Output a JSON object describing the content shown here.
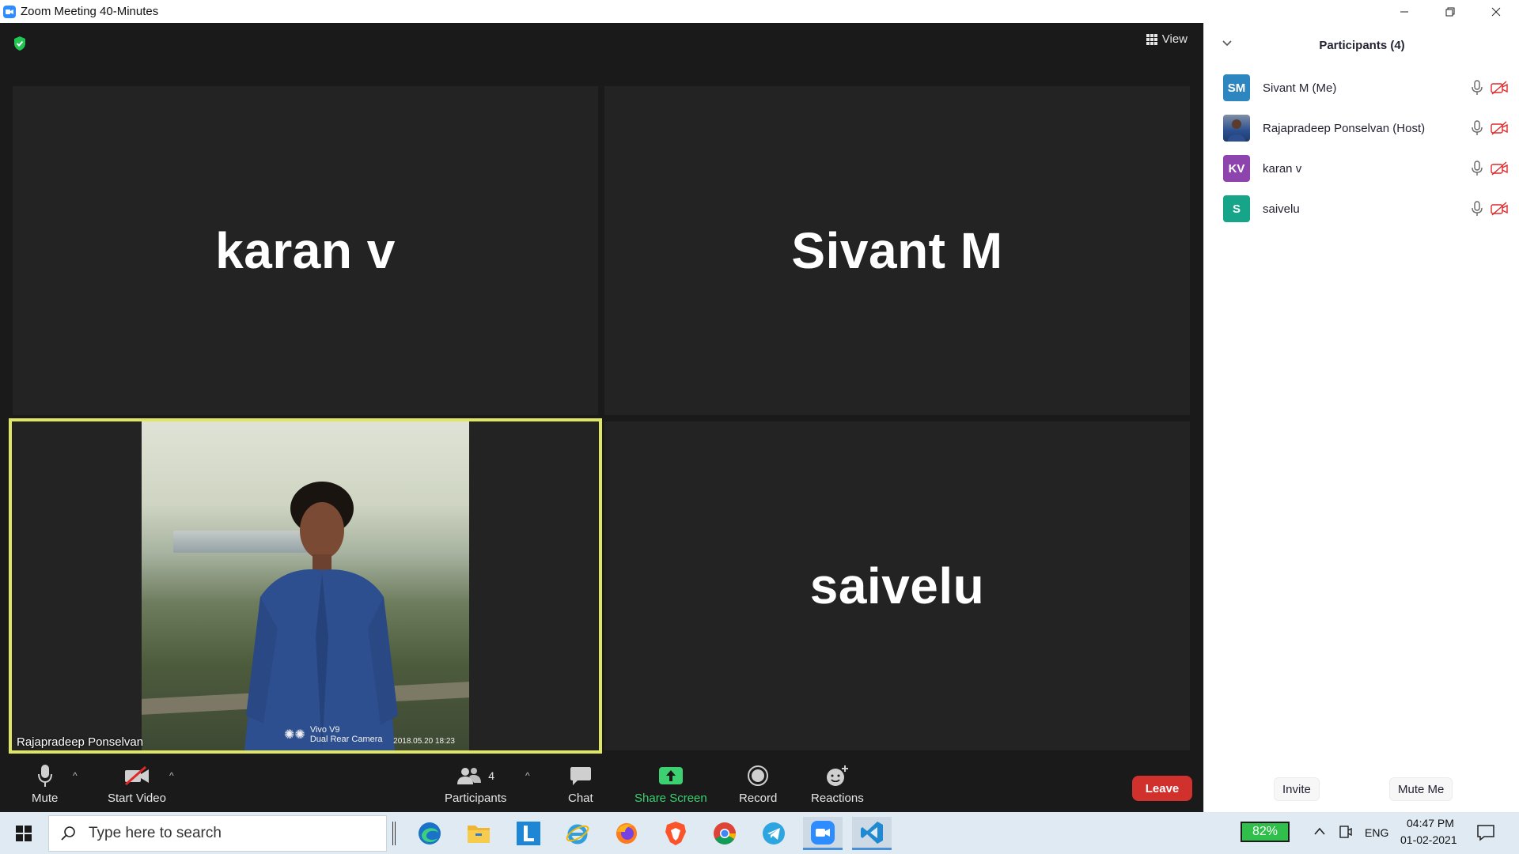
{
  "window": {
    "title": "Zoom Meeting 40-Minutes",
    "controls": [
      "minimize",
      "restore",
      "close"
    ]
  },
  "meeting": {
    "view_label": "View",
    "tiles": [
      {
        "name": "karan v"
      },
      {
        "name": "Sivant M"
      },
      {
        "name": "Rajapradeep Ponselvan",
        "video": true,
        "camera_watermark_1": "Vivo V9",
        "camera_watermark_2": "Dual Rear Camera",
        "photo_date": "2018.05.20 18:23"
      },
      {
        "name": "saivelu"
      }
    ]
  },
  "toolbar": {
    "mute": "Mute",
    "start_video": "Start Video",
    "participants": "Participants",
    "participants_count": "4",
    "chat": "Chat",
    "share_screen": "Share Screen",
    "record": "Record",
    "reactions": "Reactions",
    "leave": "Leave"
  },
  "panel": {
    "header": "Participants (4)",
    "participants": [
      {
        "initials": "SM",
        "name": "Sivant M (Me)",
        "color": "#2e86c1"
      },
      {
        "initials": "",
        "name": "Rajapradeep Ponselvan (Host)",
        "color": "#3b5a8a"
      },
      {
        "initials": "KV",
        "name": "karan v",
        "color": "#8e44ad"
      },
      {
        "initials": "S",
        "name": "saivelu",
        "color": "#17a589"
      }
    ],
    "invite": "Invite",
    "mute_me": "Mute Me"
  },
  "taskbar": {
    "search_placeholder": "Type here to search",
    "battery": "82%",
    "language": "ENG",
    "time": "04:47 PM",
    "date": "01-02-2021"
  },
  "colors": {
    "accent_green": "#3cd070",
    "leave_red": "#d0312d",
    "active_speaker_border": "#dfe663"
  }
}
